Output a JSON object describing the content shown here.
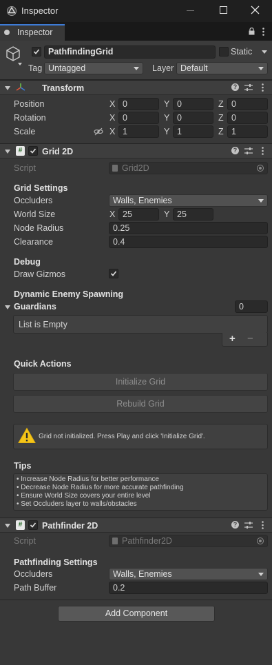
{
  "window": {
    "title": "Inspector"
  },
  "tab": {
    "label": "Inspector"
  },
  "object": {
    "name": "PathfindingGrid",
    "static_label": "Static",
    "tag_label": "Tag",
    "tag_value": "Untagged",
    "layer_label": "Layer",
    "layer_value": "Default"
  },
  "transform": {
    "title": "Transform",
    "position_label": "Position",
    "rotation_label": "Rotation",
    "scale_label": "Scale",
    "x": "X",
    "y": "Y",
    "z": "Z",
    "position": [
      "0",
      "0",
      "0"
    ],
    "rotation": [
      "0",
      "0",
      "0"
    ],
    "scale": [
      "1",
      "1",
      "1"
    ]
  },
  "grid2d": {
    "title": "Grid 2D",
    "script_label": "Script",
    "script_value": "Grid2D",
    "settings_header": "Grid Settings",
    "occluders_label": "Occluders",
    "occluders_value": "Walls, Enemies",
    "world_size_label": "World Size",
    "world_size_x": "25",
    "world_size_y": "25",
    "node_radius_label": "Node Radius",
    "node_radius_value": "0.25",
    "clearance_label": "Clearance",
    "clearance_value": "0.4",
    "debug_header": "Debug",
    "draw_gizmos_label": "Draw Gizmos",
    "spawning_header": "Dynamic Enemy Spawning",
    "guardians_label": "Guardians",
    "guardians_count": "0",
    "list_empty": "List is Empty",
    "plus": "+",
    "minus": "−",
    "quick_actions_header": "Quick Actions",
    "init_button": "Initialize Grid",
    "rebuild_button": "Rebuild Grid",
    "warning_text": "Grid not initialized. Press Play and click 'Initialize Grid'.",
    "tips_header": "Tips",
    "tips": [
      "• Increase Node Radius for better performance",
      "• Decrease Node Radius for more accurate pathfinding",
      "• Ensure World Size covers your entire level",
      "• Set Occluders layer to walls/obstacles"
    ]
  },
  "pathfinder2d": {
    "title": "Pathfinder 2D",
    "script_label": "Script",
    "script_value": "Pathfinder2D",
    "settings_header": "Pathfinding Settings",
    "occluders_label": "Occluders",
    "occluders_value": "Walls, Enemies",
    "path_buffer_label": "Path Buffer",
    "path_buffer_value": "0.2"
  },
  "add_component": "Add Component",
  "colors": {
    "background": "#383838",
    "titlebar": "#1f1f1f",
    "field": "#2a2a2a",
    "warning": "#f5c518"
  }
}
